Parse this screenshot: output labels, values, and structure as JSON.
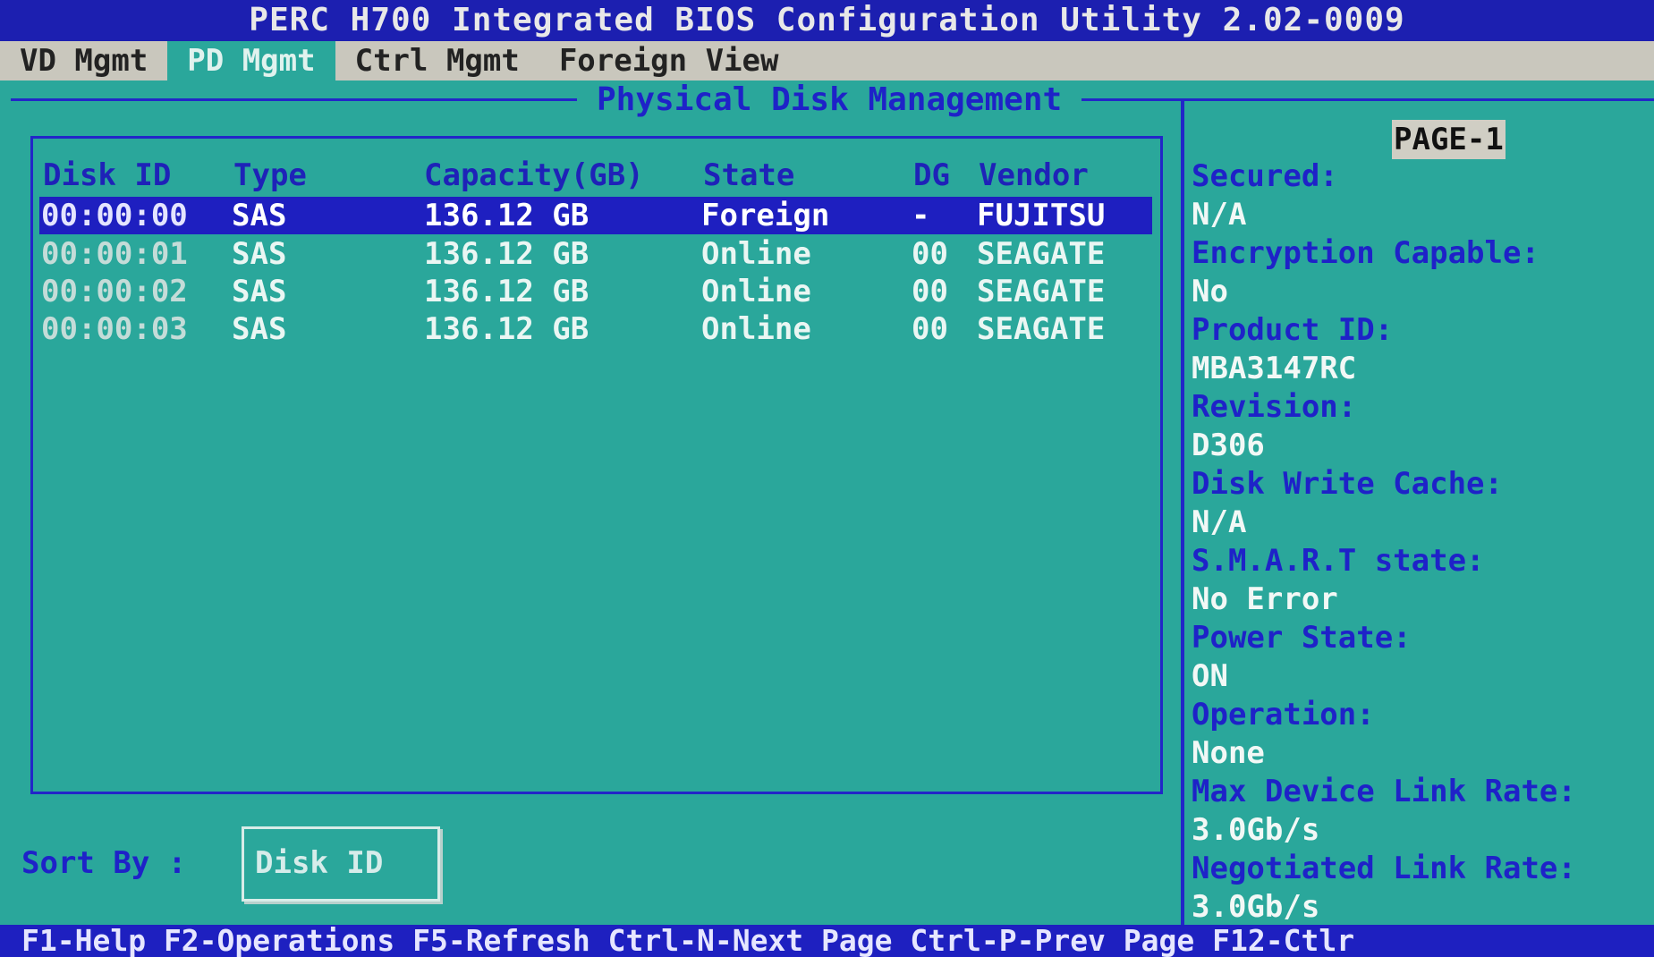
{
  "window": {
    "title": "PERC H700 Integrated BIOS Configuration Utility 2.02-0009"
  },
  "menu": {
    "tabs": [
      {
        "label": "VD Mgmt"
      },
      {
        "label": "PD Mgmt"
      },
      {
        "label": "Ctrl Mgmt"
      },
      {
        "label": "Foreign View"
      }
    ],
    "active": "PD Mgmt"
  },
  "main": {
    "section_title": "Physical Disk Management",
    "columns": {
      "disk_id": "Disk ID",
      "type": "Type",
      "capacity": "Capacity(GB)",
      "state": "State",
      "dg": "DG",
      "vendor": "Vendor"
    },
    "rows": [
      {
        "disk_id": "00:00:00",
        "type": "SAS",
        "capacity": "136.12 GB",
        "state": "Foreign",
        "dg": "-",
        "vendor": "FUJITSU"
      },
      {
        "disk_id": "00:00:01",
        "type": "SAS",
        "capacity": "136.12 GB",
        "state": "Online",
        "dg": "00",
        "vendor": "SEAGATE"
      },
      {
        "disk_id": "00:00:02",
        "type": "SAS",
        "capacity": "136.12 GB",
        "state": "Online",
        "dg": "00",
        "vendor": "SEAGATE"
      },
      {
        "disk_id": "00:00:03",
        "type": "SAS",
        "capacity": "136.12 GB",
        "state": "Online",
        "dg": "00",
        "vendor": "SEAGATE"
      }
    ],
    "selected_row": 0,
    "sort_label": "Sort By :",
    "sort_value": "Disk ID"
  },
  "details": {
    "page": "PAGE-1",
    "fields": [
      {
        "label": "Secured:",
        "value": "N/A"
      },
      {
        "label": "Encryption Capable:",
        "value": "No"
      },
      {
        "label": "Product ID:",
        "value": "MBA3147RC"
      },
      {
        "label": "Revision:",
        "value": "D306"
      },
      {
        "label": "Disk Write Cache:",
        "value": "N/A"
      },
      {
        "label": "S.M.A.R.T state:",
        "value": "No Error"
      },
      {
        "label": "Power State:",
        "value": "ON"
      },
      {
        "label": "Operation:",
        "value": "None"
      },
      {
        "label": "Max Device Link Rate:",
        "value": "3.0Gb/s"
      },
      {
        "label": "Negotiated Link Rate:",
        "value": "3.0Gb/s"
      }
    ]
  },
  "status_bar": {
    "text": "F1-Help F2-Operations F5-Refresh Ctrl-N-Next Page Ctrl-P-Prev Page F12-Ctlr"
  },
  "colors": {
    "background": "#2aa79b",
    "highlight": "#1e1fc0",
    "label_blue": "#1e22c8",
    "menu_bar": "#c9c7bd"
  }
}
